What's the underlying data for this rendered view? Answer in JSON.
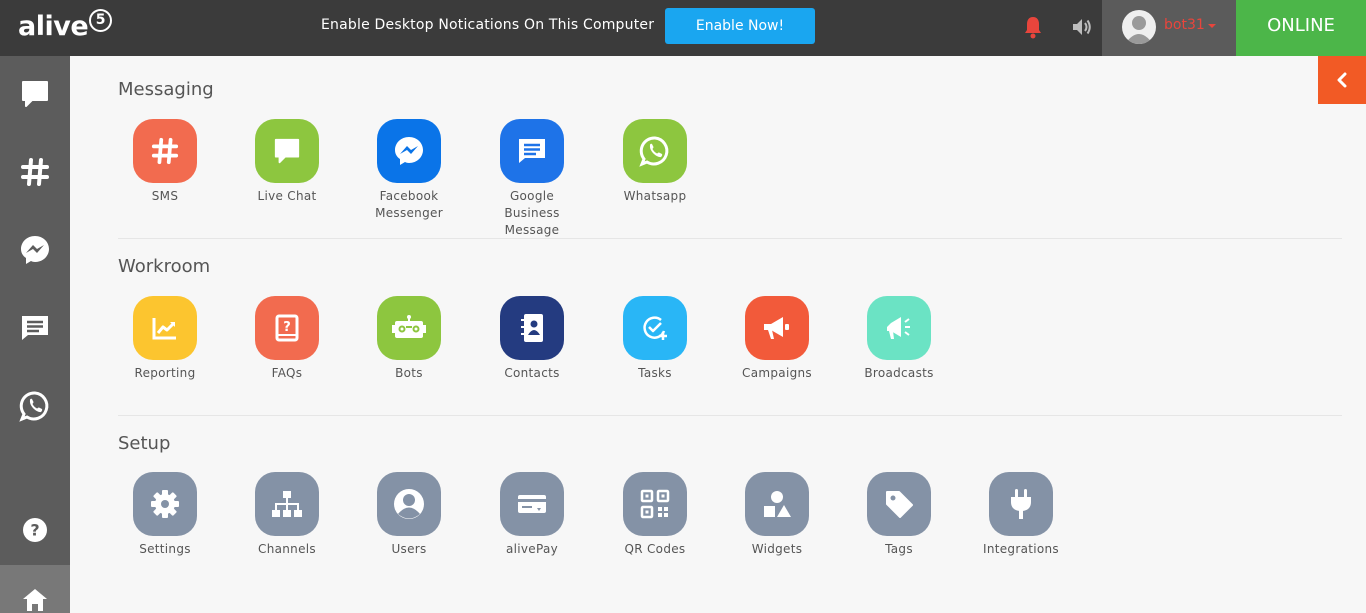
{
  "header": {
    "logo_text": "alive",
    "logo_badge": "5",
    "notice": "Enable Desktop Notications On This Computer",
    "enable_button": "Enable Now!",
    "username": "bot31",
    "status": "ONLINE"
  },
  "colors": {
    "topbar": "#3b3b3b",
    "online": "#4cb649",
    "accent_blue": "#1aa6f0",
    "collapse_tab": "#f25a25",
    "bell": "#e8453c"
  },
  "sidebar": {
    "items": [
      {
        "icon": "chat-bubble-icon"
      },
      {
        "icon": "hashtag-icon"
      },
      {
        "icon": "messenger-icon"
      },
      {
        "icon": "message-lines-icon"
      },
      {
        "icon": "whatsapp-icon"
      },
      {
        "icon": "help-icon"
      },
      {
        "icon": "home-icon"
      }
    ]
  },
  "sections": {
    "messaging": {
      "title": "Messaging",
      "tiles": [
        {
          "label": "SMS",
          "icon": "hashtag-icon",
          "color": "#f26b4f"
        },
        {
          "label": "Live Chat",
          "icon": "chat-bubble-icon",
          "color": "#8dc63f"
        },
        {
          "label": "Facebook Messenger",
          "icon": "messenger-icon",
          "color": "#0a74e8"
        },
        {
          "label": "Google Business Message",
          "icon": "message-lines-icon",
          "color": "#1e73e8"
        },
        {
          "label": "Whatsapp",
          "icon": "whatsapp-icon",
          "color": "#8dc63f"
        }
      ]
    },
    "workroom": {
      "title": "Workroom",
      "tiles": [
        {
          "label": "Reporting",
          "icon": "chart-icon",
          "color": "#fcc52f"
        },
        {
          "label": "FAQs",
          "icon": "faq-book-icon",
          "color": "#f26b4f"
        },
        {
          "label": "Bots",
          "icon": "bot-icon",
          "color": "#8dc63f"
        },
        {
          "label": "Contacts",
          "icon": "contacts-book-icon",
          "color": "#243b80"
        },
        {
          "label": "Tasks",
          "icon": "task-check-icon",
          "color": "#29b6f6"
        },
        {
          "label": "Campaigns",
          "icon": "megaphone-icon",
          "color": "#f25a3a"
        },
        {
          "label": "Broadcasts",
          "icon": "broadcast-icon",
          "color": "#6be3c4"
        }
      ]
    },
    "setup": {
      "title": "Setup",
      "tiles": [
        {
          "label": "Settings",
          "icon": "gear-icon",
          "color": "#8492a6"
        },
        {
          "label": "Channels",
          "icon": "sitemap-icon",
          "color": "#8492a6"
        },
        {
          "label": "Users",
          "icon": "user-icon",
          "color": "#8492a6"
        },
        {
          "label": "alivePay",
          "icon": "payment-card-icon",
          "color": "#8492a6"
        },
        {
          "label": "QR Codes",
          "icon": "qr-code-icon",
          "color": "#8492a6"
        },
        {
          "label": "Widgets",
          "icon": "shapes-icon",
          "color": "#8492a6"
        },
        {
          "label": "Tags",
          "icon": "tag-icon",
          "color": "#8492a6"
        },
        {
          "label": "Integrations",
          "icon": "plug-icon",
          "color": "#8492a6"
        }
      ]
    }
  }
}
